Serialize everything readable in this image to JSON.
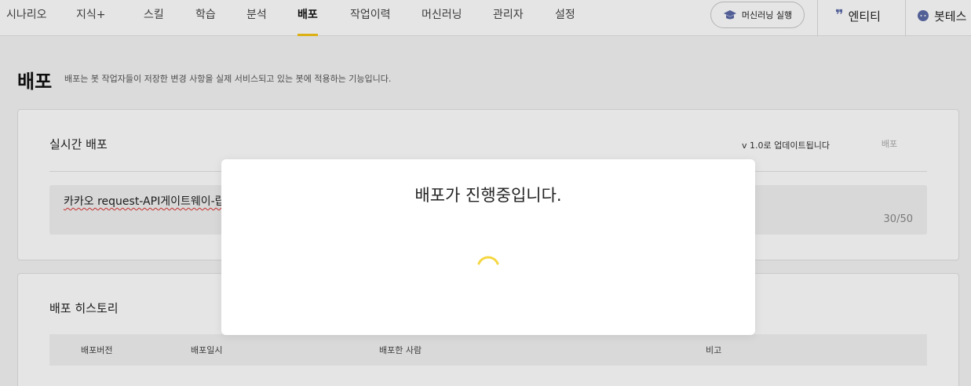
{
  "nav": {
    "tabs": [
      "시나리오",
      "지식+",
      "스킬",
      "학습",
      "분석",
      "배포",
      "작업이력",
      "머신러닝",
      "관리자",
      "설정"
    ],
    "active_tab": "배포",
    "ml_run_label": "머신러닝 실행",
    "entity_label": "엔티티",
    "bot_test_label": "봇테스"
  },
  "page": {
    "title": "배포",
    "description": "배포는 봇 작업자들이 저장한 변경 사항을 실제 서비스되고 있는 봇에 적용하는 기능입니다."
  },
  "realtime": {
    "title": "실시간 배포",
    "update_note": "v 1.0로 업데이트됩니다",
    "deploy_button": "배포",
    "message": "카카오 request-API게이트웨이-랍",
    "char_count": "30/50"
  },
  "history": {
    "title": "배포 히스토리",
    "columns": [
      "배포버전",
      "배포일시",
      "배포한 사람",
      "비고"
    ]
  },
  "modal": {
    "title": "배포가 진행중입니다."
  },
  "colors": {
    "accent": "#f5c518",
    "icon": "#5b6aa8"
  }
}
